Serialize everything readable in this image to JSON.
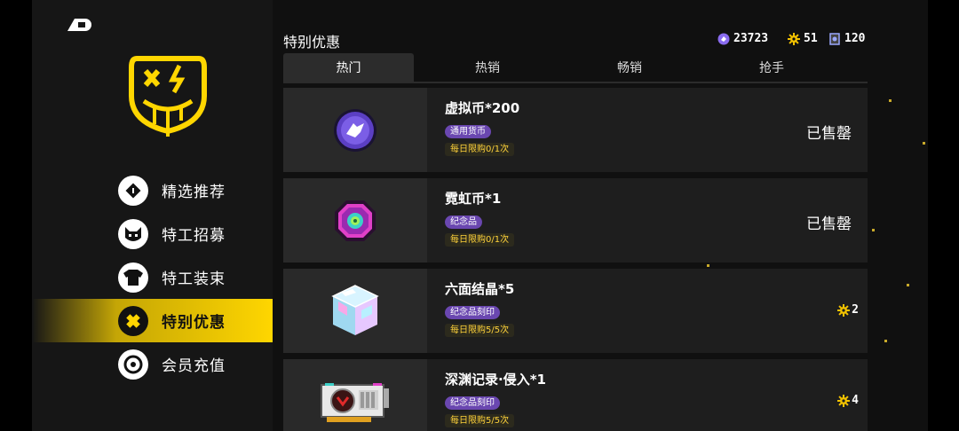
{
  "page": {
    "title": "特别优惠"
  },
  "currencies": [
    {
      "icon": "purple-coin-icon",
      "value": "23723",
      "color": "#8a6cf0"
    },
    {
      "icon": "gear-token-icon",
      "value": "51",
      "color": "#f2c200"
    },
    {
      "icon": "ticket-card-icon",
      "value": "120",
      "color": "#9aa7ff"
    }
  ],
  "sidebar": {
    "items": [
      {
        "label": "精选推荐",
        "icon": "diamond-sticker-icon",
        "active": false
      },
      {
        "label": "特工招募",
        "icon": "cat-mask-icon",
        "active": false
      },
      {
        "label": "特工装束",
        "icon": "shirt-icon",
        "active": false
      },
      {
        "label": "特别优惠",
        "icon": "ticket-cross-icon",
        "active": true
      },
      {
        "label": "会员充值",
        "icon": "target-coin-icon",
        "active": false
      }
    ]
  },
  "tabs": [
    {
      "label": "热门",
      "active": true
    },
    {
      "label": "热销",
      "active": false
    },
    {
      "label": "畅销",
      "active": false
    },
    {
      "label": "抢手",
      "active": false
    }
  ],
  "items": [
    {
      "name": "虚拟币*200",
      "tag": "通用货币",
      "limit": "每日限购0/1次",
      "status": "已售罄",
      "price": null,
      "icon": "virtual-coin-icon"
    },
    {
      "name": "霓虹币*1",
      "tag": "纪念品",
      "limit": "每日限购0/1次",
      "status": "已售罄",
      "price": null,
      "icon": "neon-coin-icon"
    },
    {
      "name": "六面结晶*5",
      "tag": "纪念品刻印",
      "limit": "每日限购5/5次",
      "status": "",
      "price": "2",
      "icon": "crystal-cube-icon"
    },
    {
      "name": "深渊记录·侵入*1",
      "tag": "纪念品刻印",
      "limit": "每日限购5/5次",
      "status": "",
      "price": "4",
      "icon": "graphics-card-icon"
    }
  ],
  "colors": {
    "accent": "#ffd600",
    "tag_purple": "#6a47b0",
    "limit_text": "#ffd23a"
  }
}
